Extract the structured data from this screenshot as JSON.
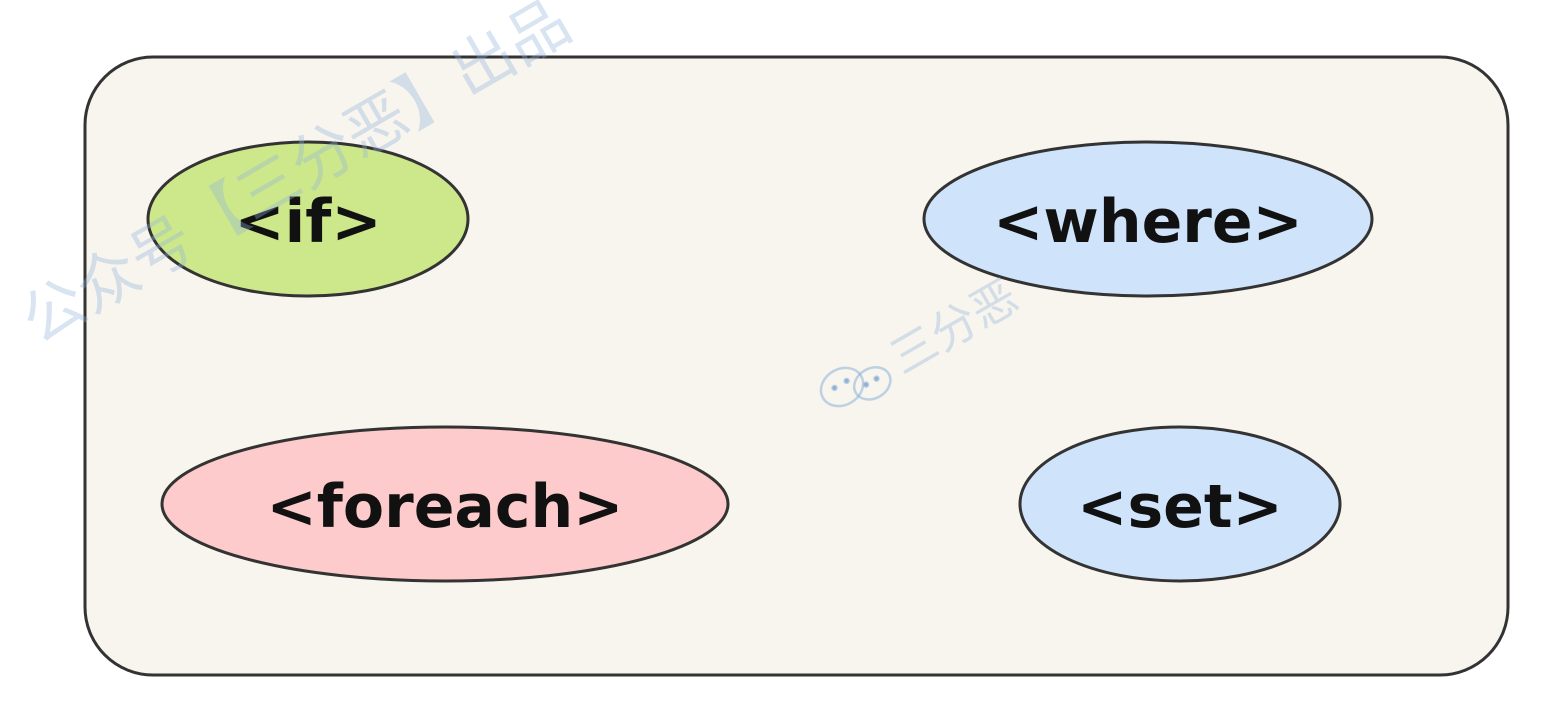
{
  "diagram": {
    "container": {
      "fill": "#f7f5ee",
      "stroke": "#333333"
    },
    "nodes": [
      {
        "id": "if",
        "label": "<if>",
        "fill": "#cde88a"
      },
      {
        "id": "where",
        "label": "<where>",
        "fill": "#cfe3fb"
      },
      {
        "id": "foreach",
        "label": "<foreach>",
        "fill": "#fdcbcb"
      },
      {
        "id": "set",
        "label": "<set>",
        "fill": "#cfe3fb"
      }
    ]
  },
  "watermark": {
    "top_text": "公众号【三分恶】出品",
    "center_text": "三分恶",
    "icon": "wechat-icon",
    "color": "#8fb2d9"
  }
}
